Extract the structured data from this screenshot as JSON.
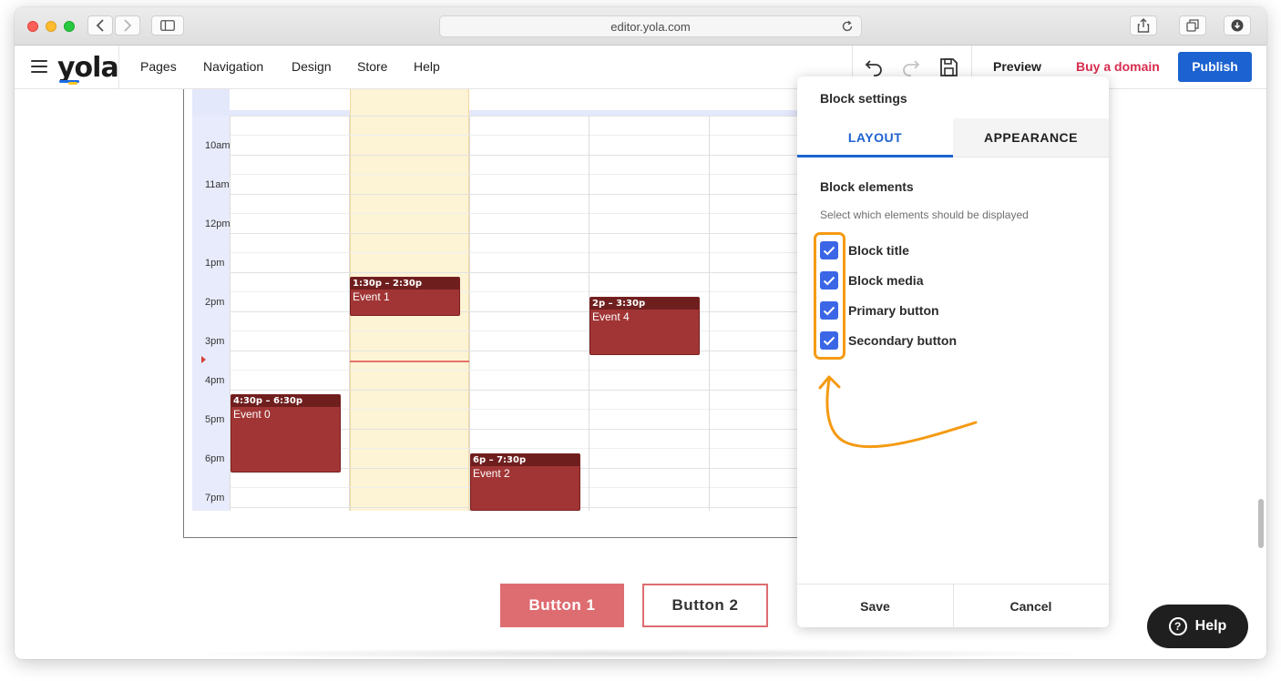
{
  "browser": {
    "url": "editor.yola.com"
  },
  "header": {
    "logo": "yola",
    "menu": [
      "Pages",
      "Navigation",
      "Design",
      "Store",
      "Help"
    ],
    "preview_label": "Preview",
    "buy_domain_label": "Buy a domain",
    "publish_label": "Publish"
  },
  "calendar": {
    "hours": [
      "10am",
      "11am",
      "12pm",
      "1pm",
      "2pm",
      "3pm",
      "4pm",
      "5pm",
      "6pm",
      "7pm"
    ],
    "events": [
      {
        "time": "1:30p – 2:30p",
        "title": "Event 1"
      },
      {
        "time": "2p – 3:30p",
        "title": "Event 4"
      },
      {
        "time": "4:30p – 6:30p",
        "title": "Event 0"
      },
      {
        "time": "6p – 7:30p",
        "title": "Event 2"
      }
    ]
  },
  "block_buttons": {
    "button1": "Button 1",
    "button2": "Button 2"
  },
  "panel": {
    "title": "Block settings",
    "tabs": {
      "layout": "LAYOUT",
      "appearance": "APPEARANCE"
    },
    "section_title": "Block elements",
    "section_subtitle": "Select which elements should be displayed",
    "elements": [
      {
        "label": "Block title",
        "checked": true
      },
      {
        "label": "Block media",
        "checked": true
      },
      {
        "label": "Primary button",
        "checked": true
      },
      {
        "label": "Secondary button",
        "checked": true
      }
    ],
    "save_label": "Save",
    "cancel_label": "Cancel"
  },
  "help_button": {
    "label": "Help"
  },
  "colors": {
    "publish": "#1c62d0",
    "buy_domain": "#d82c4e",
    "event": "#a13535",
    "checkbox": "#3b66e6",
    "annotation": "#f59a13",
    "button_primary": "#de6d72"
  }
}
